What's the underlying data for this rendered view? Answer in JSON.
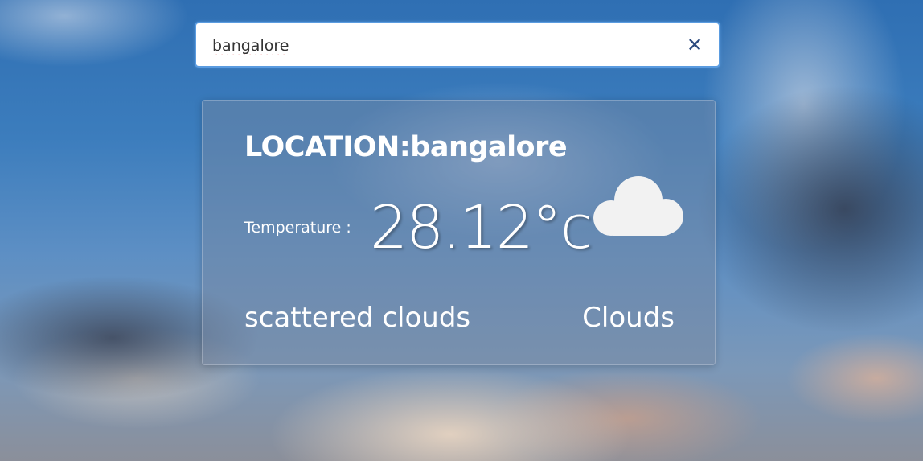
{
  "search": {
    "value": "bangalore",
    "clear_icon": "close-icon",
    "clear_glyph": "✕"
  },
  "weather": {
    "location_title": "LOCATION:bangalore",
    "temperature_label": "Temperature :",
    "temperature_value": "28.12°c",
    "description": "scattered clouds",
    "condition": "Clouds",
    "condition_icon": "cloud-icon"
  },
  "colors": {
    "search_border": "#5b9ce0",
    "clear_icon": "#2b4a7e",
    "card_text": "#ffffff"
  }
}
